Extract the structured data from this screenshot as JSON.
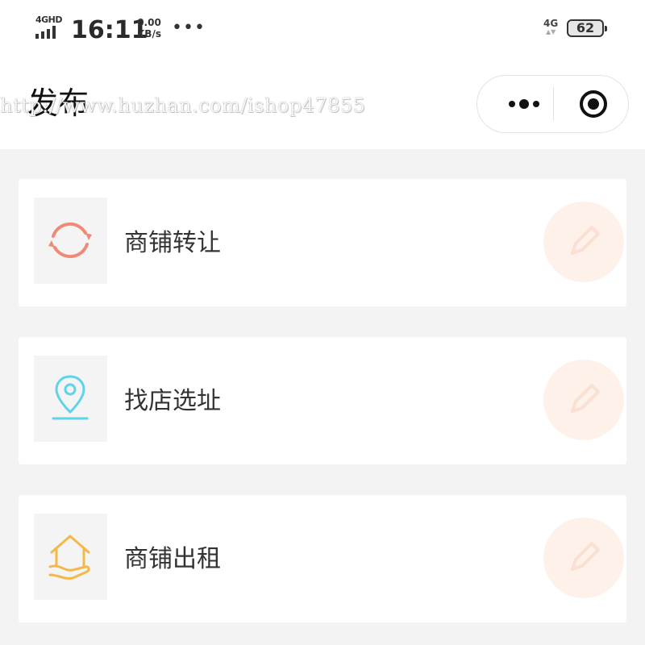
{
  "status_bar": {
    "network_label": "4GHD",
    "time": "16:11",
    "speed_value": "0.00",
    "speed_unit": "KB/s",
    "more_dots": "•••",
    "network_type": "4G",
    "battery_level": "62"
  },
  "nav": {
    "title": "发布",
    "watermark": "http://www.huzhan.com/ishop47855"
  },
  "items": [
    {
      "label": "商铺转让",
      "icon": "refresh-icon",
      "color": "#f08a78"
    },
    {
      "label": "找店选址",
      "icon": "location-pin-icon",
      "color": "#5fd3e8"
    },
    {
      "label": "商铺出租",
      "icon": "house-hand-icon",
      "color": "#f4b84a"
    }
  ],
  "colors": {
    "edit_accent": "#f7c9b2",
    "page_bg": "#f3f3f3"
  }
}
